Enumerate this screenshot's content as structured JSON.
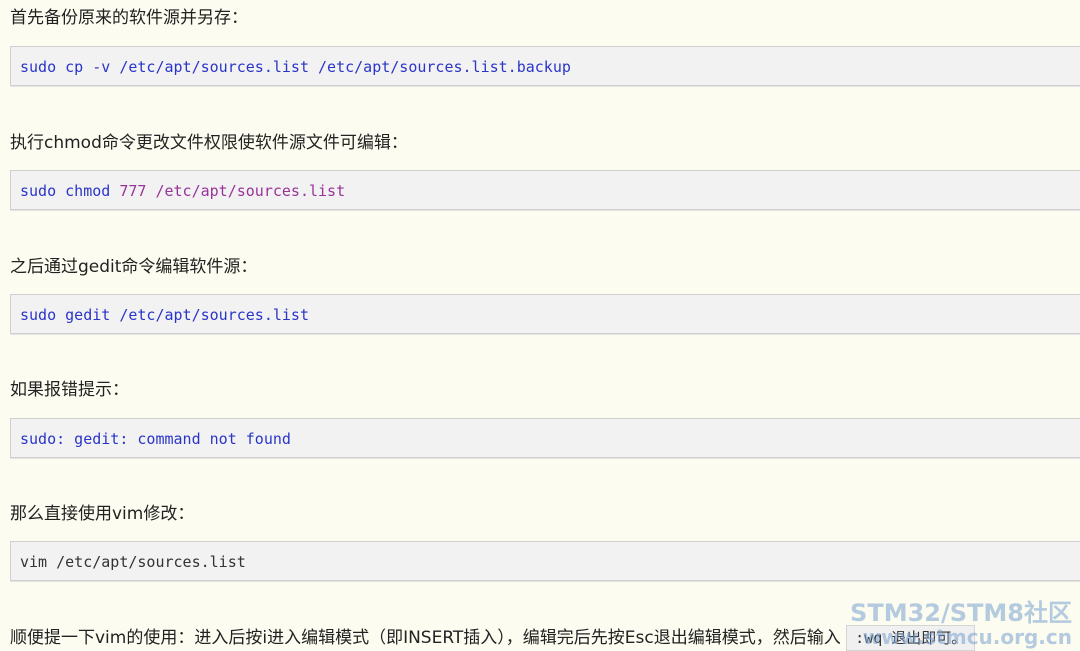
{
  "steps": [
    {
      "text": "首先备份原来的软件源并另存：",
      "code_cmd": "sudo cp -v",
      "code_rest": " /etc/apt/sources.list /etc/apt/sources.list.backup"
    },
    {
      "text": "执行chmod命令更改文件权限使软件源文件可编辑：",
      "code_cmd": "sudo chmod",
      "code_num": " 777",
      "code_rest": " /etc/apt/sources.list"
    },
    {
      "text": "之后通过gedit命令编辑软件源：",
      "code": "sudo gedit /etc/apt/sources.list"
    },
    {
      "text": "如果报错提示：",
      "code": "sudo: gedit: command not found"
    },
    {
      "text": "那么直接使用vim修改：",
      "code": "vim /etc/apt/sources.list"
    }
  ],
  "final": {
    "text": "顺便提一下vim的使用：进入后按i进入编辑模式（即INSERT插入），编辑完后先按Esc退出编辑模式，然后输入",
    "inline_code": ":wq 退出即可。"
  },
  "watermark": {
    "line1": "STM32/STM8社区",
    "line2": "www.stmcu.org.cn"
  },
  "colors": {
    "background": "#fcfcf0",
    "code_background": "#f2f2f2",
    "code_keyword": "#2a35c8",
    "code_number": "#993399",
    "watermark": "#78a0d2"
  }
}
